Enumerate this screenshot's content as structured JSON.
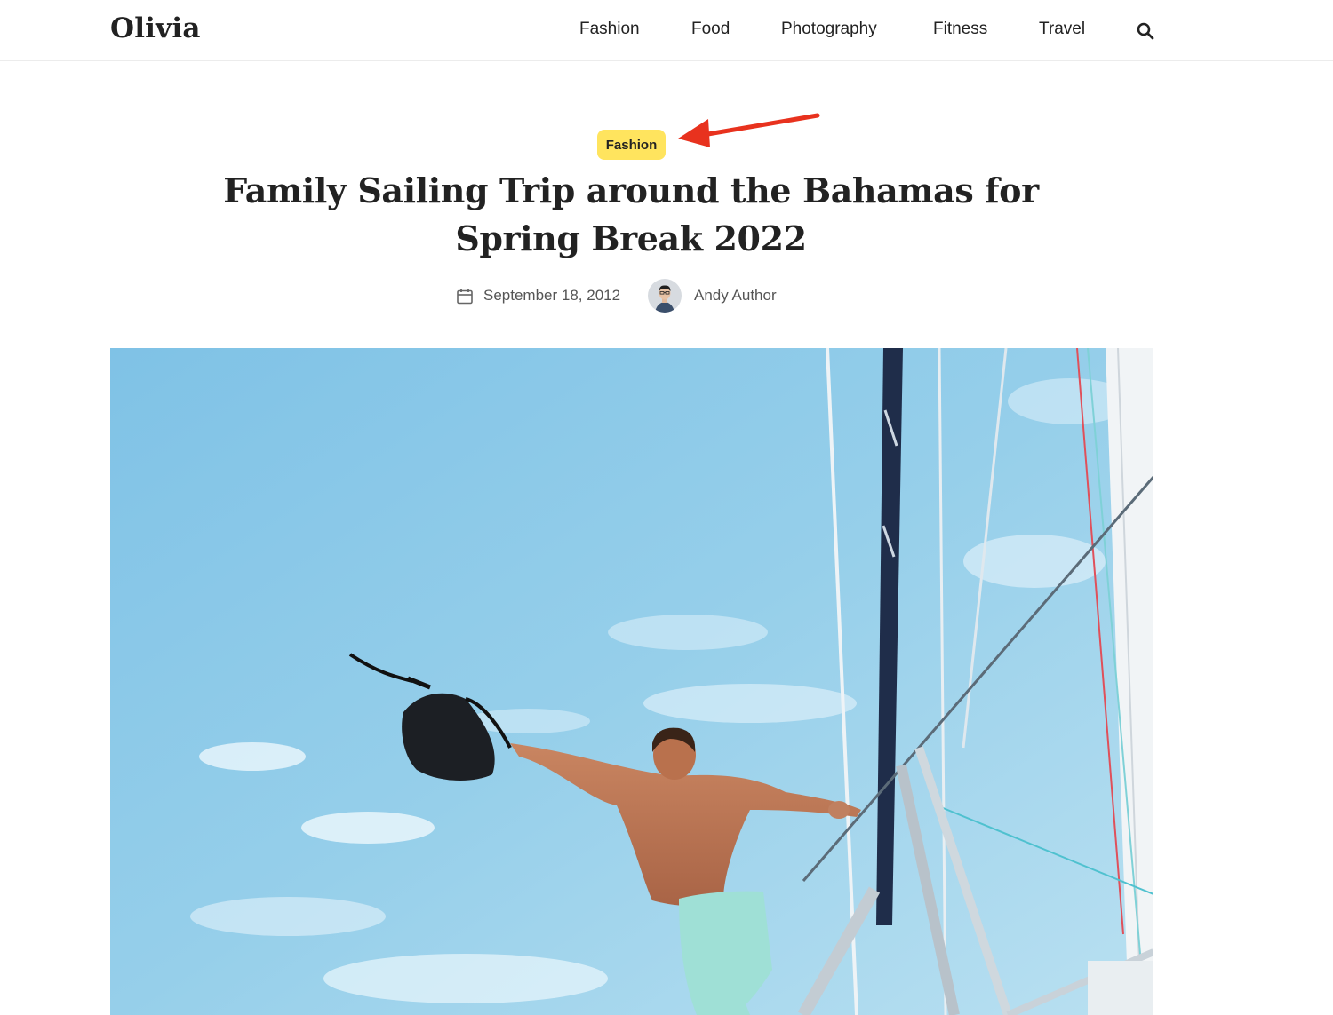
{
  "site": {
    "logo": "Olivia"
  },
  "nav": {
    "items": [
      {
        "label": "Fashion"
      },
      {
        "label": "Food"
      },
      {
        "label": "Photography"
      },
      {
        "label": "Fitness"
      },
      {
        "label": "Travel"
      }
    ],
    "search_icon": "search-icon"
  },
  "post": {
    "category": "Fashion",
    "title": "Family Sailing Trip around the Bahamas for Spring Break 2022",
    "date": "September 18, 2012",
    "author": "Andy Author",
    "date_icon": "calendar-icon"
  },
  "annotation": {
    "color": "#e8321e"
  },
  "colors": {
    "badge": "#ffe45e",
    "sky": "#8cc9e8",
    "text": "#222222"
  }
}
